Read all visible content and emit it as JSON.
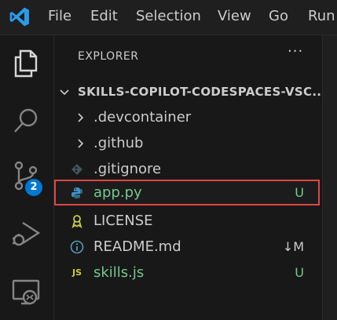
{
  "menu": [
    "File",
    "Edit",
    "Selection",
    "View",
    "Go",
    "Run"
  ],
  "activity": {
    "source_control_badge": "2"
  },
  "explorer": {
    "title": "EXPLORER",
    "more": "···",
    "folder": "SKILLS-COPILOT-CODESPACES-VSC...",
    "items": [
      {
        "name": ".devcontainer",
        "kind": "folder",
        "status": ""
      },
      {
        "name": ".github",
        "kind": "folder",
        "status": ""
      },
      {
        "name": ".gitignore",
        "kind": "git-file",
        "status": ""
      },
      {
        "name": "app.py",
        "kind": "python-file",
        "status": "U"
      },
      {
        "name": "LICENSE",
        "kind": "license-file",
        "status": ""
      },
      {
        "name": "README.md",
        "kind": "info-file",
        "status": "↓M"
      },
      {
        "name": "skills.js",
        "kind": "js-file",
        "status": "U"
      }
    ],
    "js_icon_text": "JS"
  },
  "colors": {
    "accent": "#0078d4",
    "untracked": "#73c991",
    "highlight_border": "#e04646"
  }
}
